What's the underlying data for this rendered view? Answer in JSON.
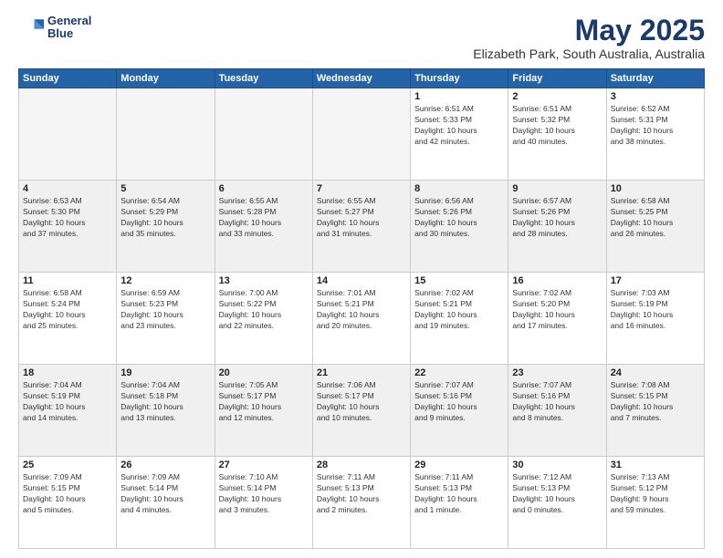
{
  "header": {
    "logo_line1": "General",
    "logo_line2": "Blue",
    "title": "May 2025",
    "subtitle": "Elizabeth Park, South Australia, Australia"
  },
  "days_of_week": [
    "Sunday",
    "Monday",
    "Tuesday",
    "Wednesday",
    "Thursday",
    "Friday",
    "Saturday"
  ],
  "weeks": [
    {
      "shaded": false,
      "days": [
        {
          "num": "",
          "info": ""
        },
        {
          "num": "",
          "info": ""
        },
        {
          "num": "",
          "info": ""
        },
        {
          "num": "",
          "info": ""
        },
        {
          "num": "1",
          "info": "Sunrise: 6:51 AM\nSunset: 5:33 PM\nDaylight: 10 hours\nand 42 minutes."
        },
        {
          "num": "2",
          "info": "Sunrise: 6:51 AM\nSunset: 5:32 PM\nDaylight: 10 hours\nand 40 minutes."
        },
        {
          "num": "3",
          "info": "Sunrise: 6:52 AM\nSunset: 5:31 PM\nDaylight: 10 hours\nand 38 minutes."
        }
      ]
    },
    {
      "shaded": true,
      "days": [
        {
          "num": "4",
          "info": "Sunrise: 6:53 AM\nSunset: 5:30 PM\nDaylight: 10 hours\nand 37 minutes."
        },
        {
          "num": "5",
          "info": "Sunrise: 6:54 AM\nSunset: 5:29 PM\nDaylight: 10 hours\nand 35 minutes."
        },
        {
          "num": "6",
          "info": "Sunrise: 6:55 AM\nSunset: 5:28 PM\nDaylight: 10 hours\nand 33 minutes."
        },
        {
          "num": "7",
          "info": "Sunrise: 6:55 AM\nSunset: 5:27 PM\nDaylight: 10 hours\nand 31 minutes."
        },
        {
          "num": "8",
          "info": "Sunrise: 6:56 AM\nSunset: 5:26 PM\nDaylight: 10 hours\nand 30 minutes."
        },
        {
          "num": "9",
          "info": "Sunrise: 6:57 AM\nSunset: 5:26 PM\nDaylight: 10 hours\nand 28 minutes."
        },
        {
          "num": "10",
          "info": "Sunrise: 6:58 AM\nSunset: 5:25 PM\nDaylight: 10 hours\nand 26 minutes."
        }
      ]
    },
    {
      "shaded": false,
      "days": [
        {
          "num": "11",
          "info": "Sunrise: 6:58 AM\nSunset: 5:24 PM\nDaylight: 10 hours\nand 25 minutes."
        },
        {
          "num": "12",
          "info": "Sunrise: 6:59 AM\nSunset: 5:23 PM\nDaylight: 10 hours\nand 23 minutes."
        },
        {
          "num": "13",
          "info": "Sunrise: 7:00 AM\nSunset: 5:22 PM\nDaylight: 10 hours\nand 22 minutes."
        },
        {
          "num": "14",
          "info": "Sunrise: 7:01 AM\nSunset: 5:21 PM\nDaylight: 10 hours\nand 20 minutes."
        },
        {
          "num": "15",
          "info": "Sunrise: 7:02 AM\nSunset: 5:21 PM\nDaylight: 10 hours\nand 19 minutes."
        },
        {
          "num": "16",
          "info": "Sunrise: 7:02 AM\nSunset: 5:20 PM\nDaylight: 10 hours\nand 17 minutes."
        },
        {
          "num": "17",
          "info": "Sunrise: 7:03 AM\nSunset: 5:19 PM\nDaylight: 10 hours\nand 16 minutes."
        }
      ]
    },
    {
      "shaded": true,
      "days": [
        {
          "num": "18",
          "info": "Sunrise: 7:04 AM\nSunset: 5:19 PM\nDaylight: 10 hours\nand 14 minutes."
        },
        {
          "num": "19",
          "info": "Sunrise: 7:04 AM\nSunset: 5:18 PM\nDaylight: 10 hours\nand 13 minutes."
        },
        {
          "num": "20",
          "info": "Sunrise: 7:05 AM\nSunset: 5:17 PM\nDaylight: 10 hours\nand 12 minutes."
        },
        {
          "num": "21",
          "info": "Sunrise: 7:06 AM\nSunset: 5:17 PM\nDaylight: 10 hours\nand 10 minutes."
        },
        {
          "num": "22",
          "info": "Sunrise: 7:07 AM\nSunset: 5:16 PM\nDaylight: 10 hours\nand 9 minutes."
        },
        {
          "num": "23",
          "info": "Sunrise: 7:07 AM\nSunset: 5:16 PM\nDaylight: 10 hours\nand 8 minutes."
        },
        {
          "num": "24",
          "info": "Sunrise: 7:08 AM\nSunset: 5:15 PM\nDaylight: 10 hours\nand 7 minutes."
        }
      ]
    },
    {
      "shaded": false,
      "days": [
        {
          "num": "25",
          "info": "Sunrise: 7:09 AM\nSunset: 5:15 PM\nDaylight: 10 hours\nand 5 minutes."
        },
        {
          "num": "26",
          "info": "Sunrise: 7:09 AM\nSunset: 5:14 PM\nDaylight: 10 hours\nand 4 minutes."
        },
        {
          "num": "27",
          "info": "Sunrise: 7:10 AM\nSunset: 5:14 PM\nDaylight: 10 hours\nand 3 minutes."
        },
        {
          "num": "28",
          "info": "Sunrise: 7:11 AM\nSunset: 5:13 PM\nDaylight: 10 hours\nand 2 minutes."
        },
        {
          "num": "29",
          "info": "Sunrise: 7:11 AM\nSunset: 5:13 PM\nDaylight: 10 hours\nand 1 minute."
        },
        {
          "num": "30",
          "info": "Sunrise: 7:12 AM\nSunset: 5:13 PM\nDaylight: 10 hours\nand 0 minutes."
        },
        {
          "num": "31",
          "info": "Sunrise: 7:13 AM\nSunset: 5:12 PM\nDaylight: 9 hours\nand 59 minutes."
        }
      ]
    }
  ]
}
